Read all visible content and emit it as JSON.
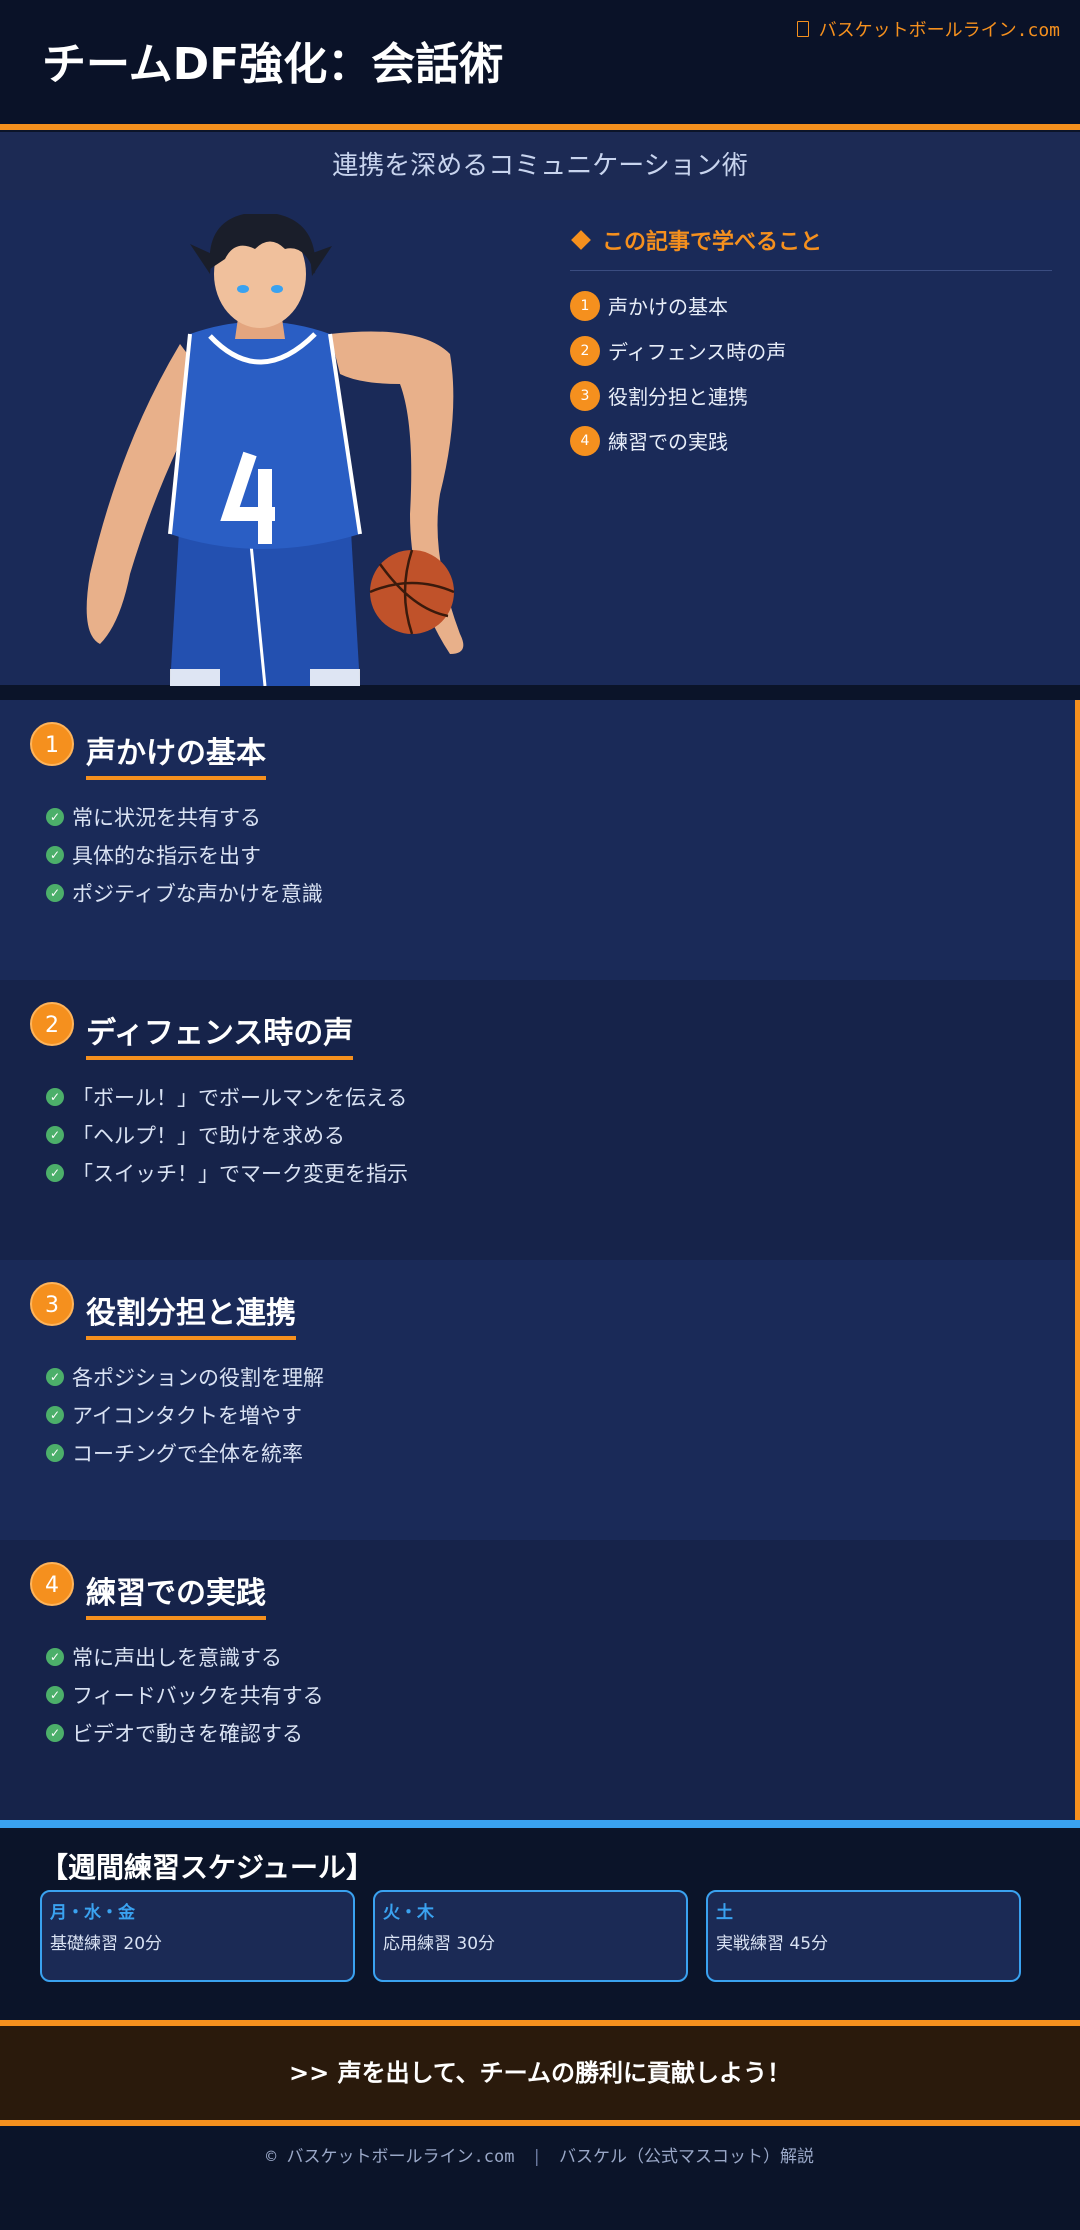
{
  "header": {
    "title": "チームDF強化：会話術",
    "site": "バスケットボールライン.com",
    "site_icon": "box-glyph"
  },
  "subtitle": "連携を深めるコミュニケーション術",
  "learn": {
    "heading": "この記事で学べること",
    "items": [
      {
        "num": "1",
        "label": "声かけの基本"
      },
      {
        "num": "2",
        "label": "ディフェンス時の声"
      },
      {
        "num": "3",
        "label": "役割分担と連携"
      },
      {
        "num": "4",
        "label": "練習での実践"
      }
    ]
  },
  "sections": [
    {
      "num": "1",
      "title": "声かけの基本",
      "bullets": [
        "常に状況を共有する",
        "具体的な指示を出す",
        "ポジティブな声かけを意識"
      ]
    },
    {
      "num": "2",
      "title": "ディフェンス時の声",
      "bullets": [
        "「ボール！」でボールマンを伝える",
        "「ヘルプ！」で助けを求める",
        "「スイッチ！」でマーク変更を指示"
      ]
    },
    {
      "num": "3",
      "title": "役割分担と連携",
      "bullets": [
        "各ポジションの役割を理解",
        "アイコンタクトを増やす",
        "コーチングで全体を統率"
      ]
    },
    {
      "num": "4",
      "title": "練習での実践",
      "bullets": [
        "常に声出しを意識する",
        "フィードバックを共有する",
        "ビデオで動きを確認する"
      ]
    }
  ],
  "schedule": {
    "title": "【週間練習スケジュール】",
    "cards": [
      {
        "days": "月・水・金",
        "detail": "基礎練習 20分"
      },
      {
        "days": "火・木",
        "detail": "応用練習 30分"
      },
      {
        "days": "土",
        "detail": "実戦練習 45分"
      }
    ]
  },
  "cta": ">> 声を出して、チームの勝利に貢献しよう！",
  "footer": {
    "site": "© バスケットボールライン.com",
    "separator": "|",
    "credit": "バスケル（公式マスコット）解説"
  },
  "colors": {
    "accent": "#f5901e",
    "blue": "#3aa2f0",
    "background": "#0b1429"
  }
}
